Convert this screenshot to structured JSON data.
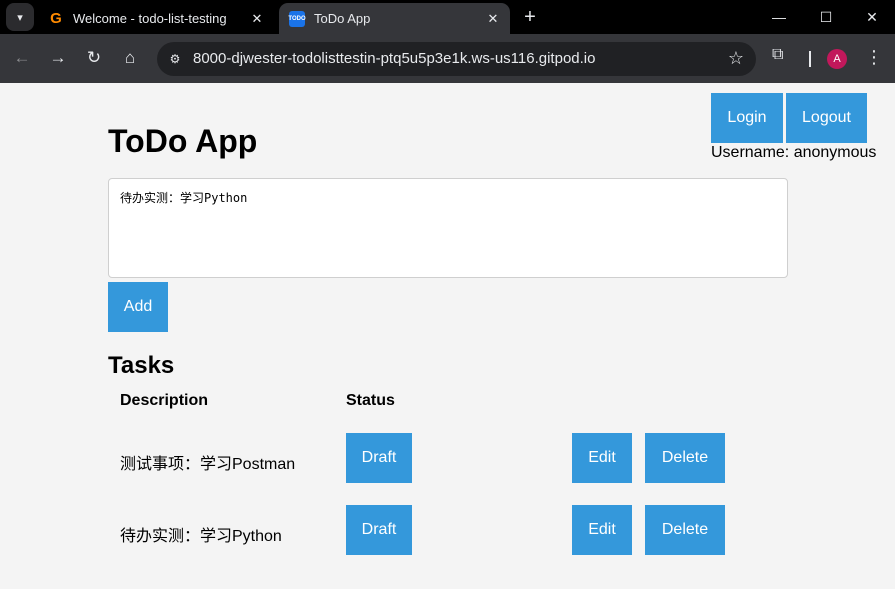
{
  "browser": {
    "tabs": [
      {
        "title": "Welcome - todo-list-testing",
        "favicon": "gitpod-icon",
        "active": false
      },
      {
        "title": "ToDo App",
        "favicon": "todo-icon",
        "favicon_text": "TODO",
        "active": true
      }
    ],
    "url": "8000-djwester-todolisttestin-ptq5u5p3e1k.ws-us116.gitpod.io",
    "profile_initial": "A",
    "icons": {
      "tab_search": "▾",
      "tab_close": "✕",
      "new_tab": "+",
      "minimize": "—",
      "maximize": "☐",
      "close": "✕",
      "back": "←",
      "forward": "→",
      "reload": "↻",
      "home": "⌂",
      "site_info": "⚙",
      "star": "☆",
      "extensions": "⧉",
      "menu": "⋮"
    }
  },
  "app": {
    "title": "ToDo App",
    "auth": {
      "login_label": "Login",
      "logout_label": "Logout",
      "username_text": "Username: anonymous"
    },
    "input": {
      "value": "待办实测：学习Python"
    },
    "add_label": "Add",
    "tasks_heading": "Tasks",
    "columns": {
      "description": "Description",
      "status": "Status"
    },
    "tasks": [
      {
        "description": "测试事项：学习Postman",
        "status": "Draft",
        "edit_label": "Edit",
        "delete_label": "Delete"
      },
      {
        "description": "待办实测：学习Python",
        "status": "Draft",
        "edit_label": "Edit",
        "delete_label": "Delete"
      }
    ],
    "colors": {
      "button": "#3498db",
      "background": "#f4f4f4"
    }
  }
}
